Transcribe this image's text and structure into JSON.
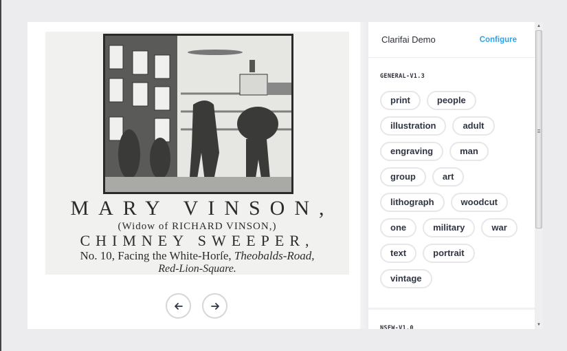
{
  "image": {
    "alt": "Woodcut trade card of a chimney sweeper",
    "caption": {
      "line1": "MARY VINSON,",
      "line2": "(Widow of RICHARD VINSON,)",
      "line3": "CHIMNEY SWEEPER,",
      "line4_plain": "No. 10, Facing the White-Horſe, ",
      "line4_italic": "Theobalds-Road,",
      "line5": "Red-Lion-Square."
    }
  },
  "nav": {
    "prev_icon": "arrow-left-icon",
    "next_icon": "arrow-right-icon"
  },
  "panel": {
    "title": "Clarifai Demo",
    "configure_label": "Configure"
  },
  "models": [
    {
      "name": "GENERAL-V1.3",
      "tags": [
        "print",
        "people",
        "illustration",
        "adult",
        "engraving",
        "man",
        "group",
        "art",
        "lithograph",
        "woodcut",
        "one",
        "military",
        "war",
        "text",
        "portrait",
        "vintage"
      ]
    },
    {
      "name": "NSFW-V1.0",
      "tags": []
    }
  ],
  "colors": {
    "accent": "#2aa3e8",
    "text": "#2f3542",
    "background": "#ececee"
  }
}
